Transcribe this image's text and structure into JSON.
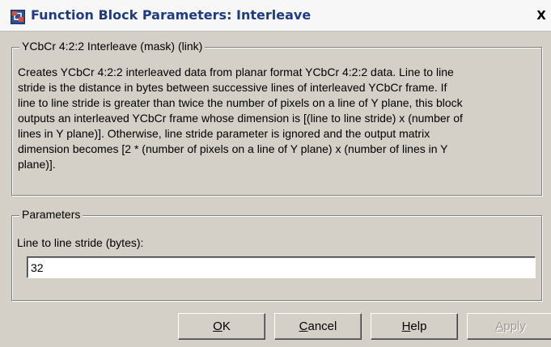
{
  "window": {
    "title": "Function Block Parameters: Interleave",
    "close_label": "X"
  },
  "description_group": {
    "legend": "YCbCr 4:2:2 Interleave (mask) (link)",
    "lines": [
      "Creates YCbCr 4:2:2 interleaved data from planar format YCbCr 4:2:2 data. Line to line",
      "stride is the distance in bytes between successive lines of interleaved YCbCr frame. If",
      "line to line stride is greater than twice the number of pixels on a line of Y plane, this block",
      "outputs an interleaved YCbCr frame whose dimension is [(line to line stride) x (number of",
      "lines in Y plane)]. Otherwise, line stride parameter is ignored and the output matrix",
      "dimension becomes [2 * (number of pixels on a line of Y plane) x (number of lines in Y",
      "plane)]."
    ]
  },
  "parameters_group": {
    "legend": "Parameters",
    "stride_label": "Line to line stride (bytes):",
    "stride_value": "32"
  },
  "buttons": {
    "ok": {
      "mnemonic": "O",
      "rest": "K"
    },
    "cancel": {
      "mnemonic": "C",
      "rest": "ancel"
    },
    "help": {
      "mnemonic": "H",
      "rest": "elp"
    },
    "apply": {
      "mnemonic": "A",
      "rest": "pply",
      "enabled": false
    }
  },
  "colors": {
    "title_text": "#1f3b85",
    "dialog_face": "#d4d0c8",
    "disabled_text": "#9d9a93"
  },
  "icons": {
    "title_icon": "simulink-block-icon",
    "close": "close-icon"
  }
}
